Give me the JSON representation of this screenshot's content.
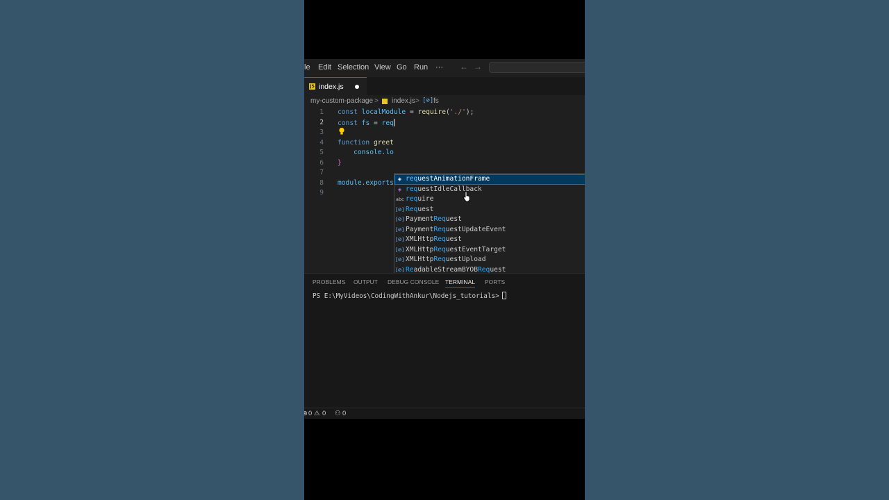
{
  "menu": {
    "items": [
      "le",
      "Edit",
      "Selection",
      "View",
      "Go",
      "Run",
      "···"
    ],
    "back_arrow": "←",
    "forward_arrow": "→"
  },
  "tab": {
    "filename": "index.js",
    "icon": "JS"
  },
  "breadcrumb": {
    "folder": "my-custom-package",
    "file": "index.js",
    "symbol": "fs",
    "separator": ">"
  },
  "editor": {
    "line_numbers": [
      "1",
      "2",
      "3",
      "4",
      "5",
      "6",
      "7",
      "8",
      "9"
    ],
    "lines": {
      "l1": {
        "kw": "const",
        "name": " localModule ",
        "eq": "= ",
        "fn": "require",
        "p1": "(",
        "str": "'./'",
        "p2": ");"
      },
      "l2": {
        "kw": "const",
        "name": " fs ",
        "eq": "= ",
        "typed": "req"
      },
      "l4": {
        "kw": "function",
        "name": " greet"
      },
      "l5": {
        "text": "    console.lo"
      },
      "l6": {
        "text": "}"
      },
      "l8": {
        "text": "module.exports"
      }
    }
  },
  "suggest": {
    "items": [
      {
        "icon": "cube-icon",
        "glyph": "◈",
        "hl": "req",
        "rest": "uestAnimationFrame"
      },
      {
        "icon": "cube-icon",
        "glyph": "◈",
        "hl": "req",
        "rest": "uestIdleCallback"
      },
      {
        "icon": "text-icon",
        "glyph": "abc",
        "hl": "req",
        "rest": "uire"
      },
      {
        "icon": "variable-icon",
        "glyph": "[⊘]",
        "hl": "Req",
        "rest": "uest"
      },
      {
        "icon": "variable-icon",
        "glyph": "[⊘]",
        "pre": "Payment",
        "hl": "Req",
        "rest": "uest"
      },
      {
        "icon": "variable-icon",
        "glyph": "[⊘]",
        "pre": "Payment",
        "hl": "Req",
        "rest": "uestUpdateEvent"
      },
      {
        "icon": "variable-icon",
        "glyph": "[⊘]",
        "pre": "XMLHttp",
        "hl": "Req",
        "rest": "uest"
      },
      {
        "icon": "variable-icon",
        "glyph": "[⊘]",
        "pre": "XMLHttp",
        "hl": "Req",
        "rest": "uestEventTarget"
      },
      {
        "icon": "variable-icon",
        "glyph": "[⊘]",
        "pre": "XMLHttp",
        "hl": "Req",
        "rest": "uestUpload"
      },
      {
        "icon": "variable-icon",
        "glyph": "[⊘]",
        "pre": "",
        "hl": "Re",
        "mid": "adableStreamBYOB",
        "hl2": "Req",
        "rest": "uest"
      }
    ]
  },
  "panel": {
    "tabs": [
      "PROBLEMS",
      "OUTPUT",
      "DEBUG CONSOLE",
      "TERMINAL",
      "PORTS"
    ],
    "active_tab": "TERMINAL",
    "prompt": "PS E:\\MyVideos\\CodingWithAnkur\\Nodejs_tutorials>"
  },
  "status": {
    "errors": "0",
    "warnings": "0",
    "ports": "0"
  },
  "colors": {
    "accent": "#0078d4",
    "editor_bg": "#1f1f1f",
    "page_bg": "#36546a",
    "js_icon": "#e8c32e"
  }
}
